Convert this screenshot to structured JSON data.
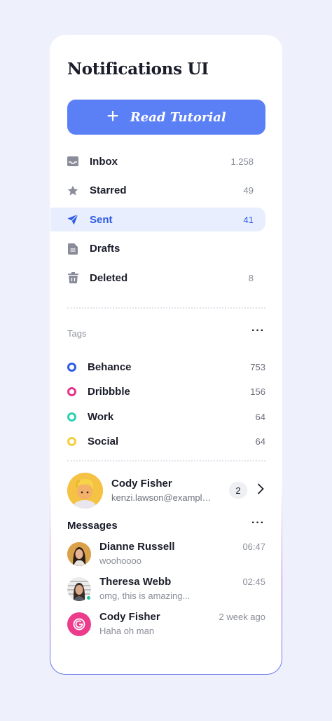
{
  "header": {
    "title": "Notifications UI"
  },
  "cta": {
    "label": "Read Tutorial",
    "icon": "plus-icon",
    "color": "#5b7ff5"
  },
  "nav": {
    "items": [
      {
        "label": "Inbox",
        "count": "1.258",
        "icon": "inbox-icon"
      },
      {
        "label": "Starred",
        "count": "49",
        "icon": "star-icon"
      },
      {
        "label": "Sent",
        "count": "41",
        "icon": "send-icon",
        "active": true
      },
      {
        "label": "Drafts",
        "count": "",
        "icon": "document-icon"
      },
      {
        "label": "Deleted",
        "count": "8",
        "icon": "trash-icon"
      }
    ]
  },
  "tags": {
    "title": "Tags",
    "more": "···",
    "items": [
      {
        "label": "Behance",
        "count": "753",
        "color": "#2d5be3"
      },
      {
        "label": "Dribbble",
        "count": "156",
        "color": "#e8338a"
      },
      {
        "label": "Work",
        "count": "64",
        "color": "#2ad1b1"
      },
      {
        "label": "Social",
        "count": "64",
        "color": "#f5cf3d"
      }
    ]
  },
  "profile": {
    "name": "Cody Fisher",
    "email": "kenzi.lawson@example.com",
    "badge": "2"
  },
  "messages": {
    "title": "Messages",
    "more": "···",
    "items": [
      {
        "name": "Dianne Russell",
        "time": "06:47",
        "preview": "woohoooo"
      },
      {
        "name": "Theresa Webb",
        "time": "02:45",
        "preview": "omg, this is amazing..."
      },
      {
        "name": "Cody Fisher",
        "time": "2 week ago",
        "preview": "Haha oh man"
      }
    ]
  }
}
